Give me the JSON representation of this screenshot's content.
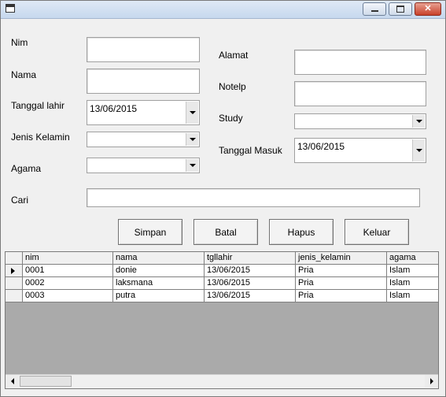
{
  "window": {
    "title": ""
  },
  "form": {
    "nim_label": "Nim",
    "nama_label": "Nama",
    "tanggal_lahir_label": "Tanggal lahir",
    "tanggal_lahir_value": "13/06/2015",
    "jenis_kelamin_label": "Jenis Kelamin",
    "jenis_kelamin_value": "",
    "agama_label": "Agama",
    "agama_value": "",
    "alamat_label": "Alamat",
    "notelp_label": "Notelp",
    "study_label": "Study",
    "study_value": "",
    "tanggal_masuk_label": "Tanggal Masuk",
    "tanggal_masuk_value": "13/06/2015",
    "cari_label": "Cari"
  },
  "buttons": {
    "simpan": "Simpan",
    "batal": "Batal",
    "hapus": "Hapus",
    "keluar": "Keluar"
  },
  "grid": {
    "columns": [
      "nim",
      "nama",
      "tgllahir",
      "jenis_kelamin",
      "agama"
    ],
    "rows": [
      [
        "0001",
        "donie",
        "13/06/2015",
        "Pria",
        "Islam"
      ],
      [
        "0002",
        "laksmana",
        "13/06/2015",
        "Pria",
        "Islam"
      ],
      [
        "0003",
        "putra",
        "13/06/2015",
        "Pria",
        "Islam"
      ]
    ]
  },
  "icons": {
    "app": "window-icon",
    "minimize": "minimize-icon",
    "maximize": "maximize-icon",
    "close": "close-icon",
    "dropdown": "chevron-down-icon",
    "row_pointer": "current-row-indicator-icon",
    "scroll_left": "scroll-left-icon",
    "scroll_right": "scroll-right-icon"
  }
}
